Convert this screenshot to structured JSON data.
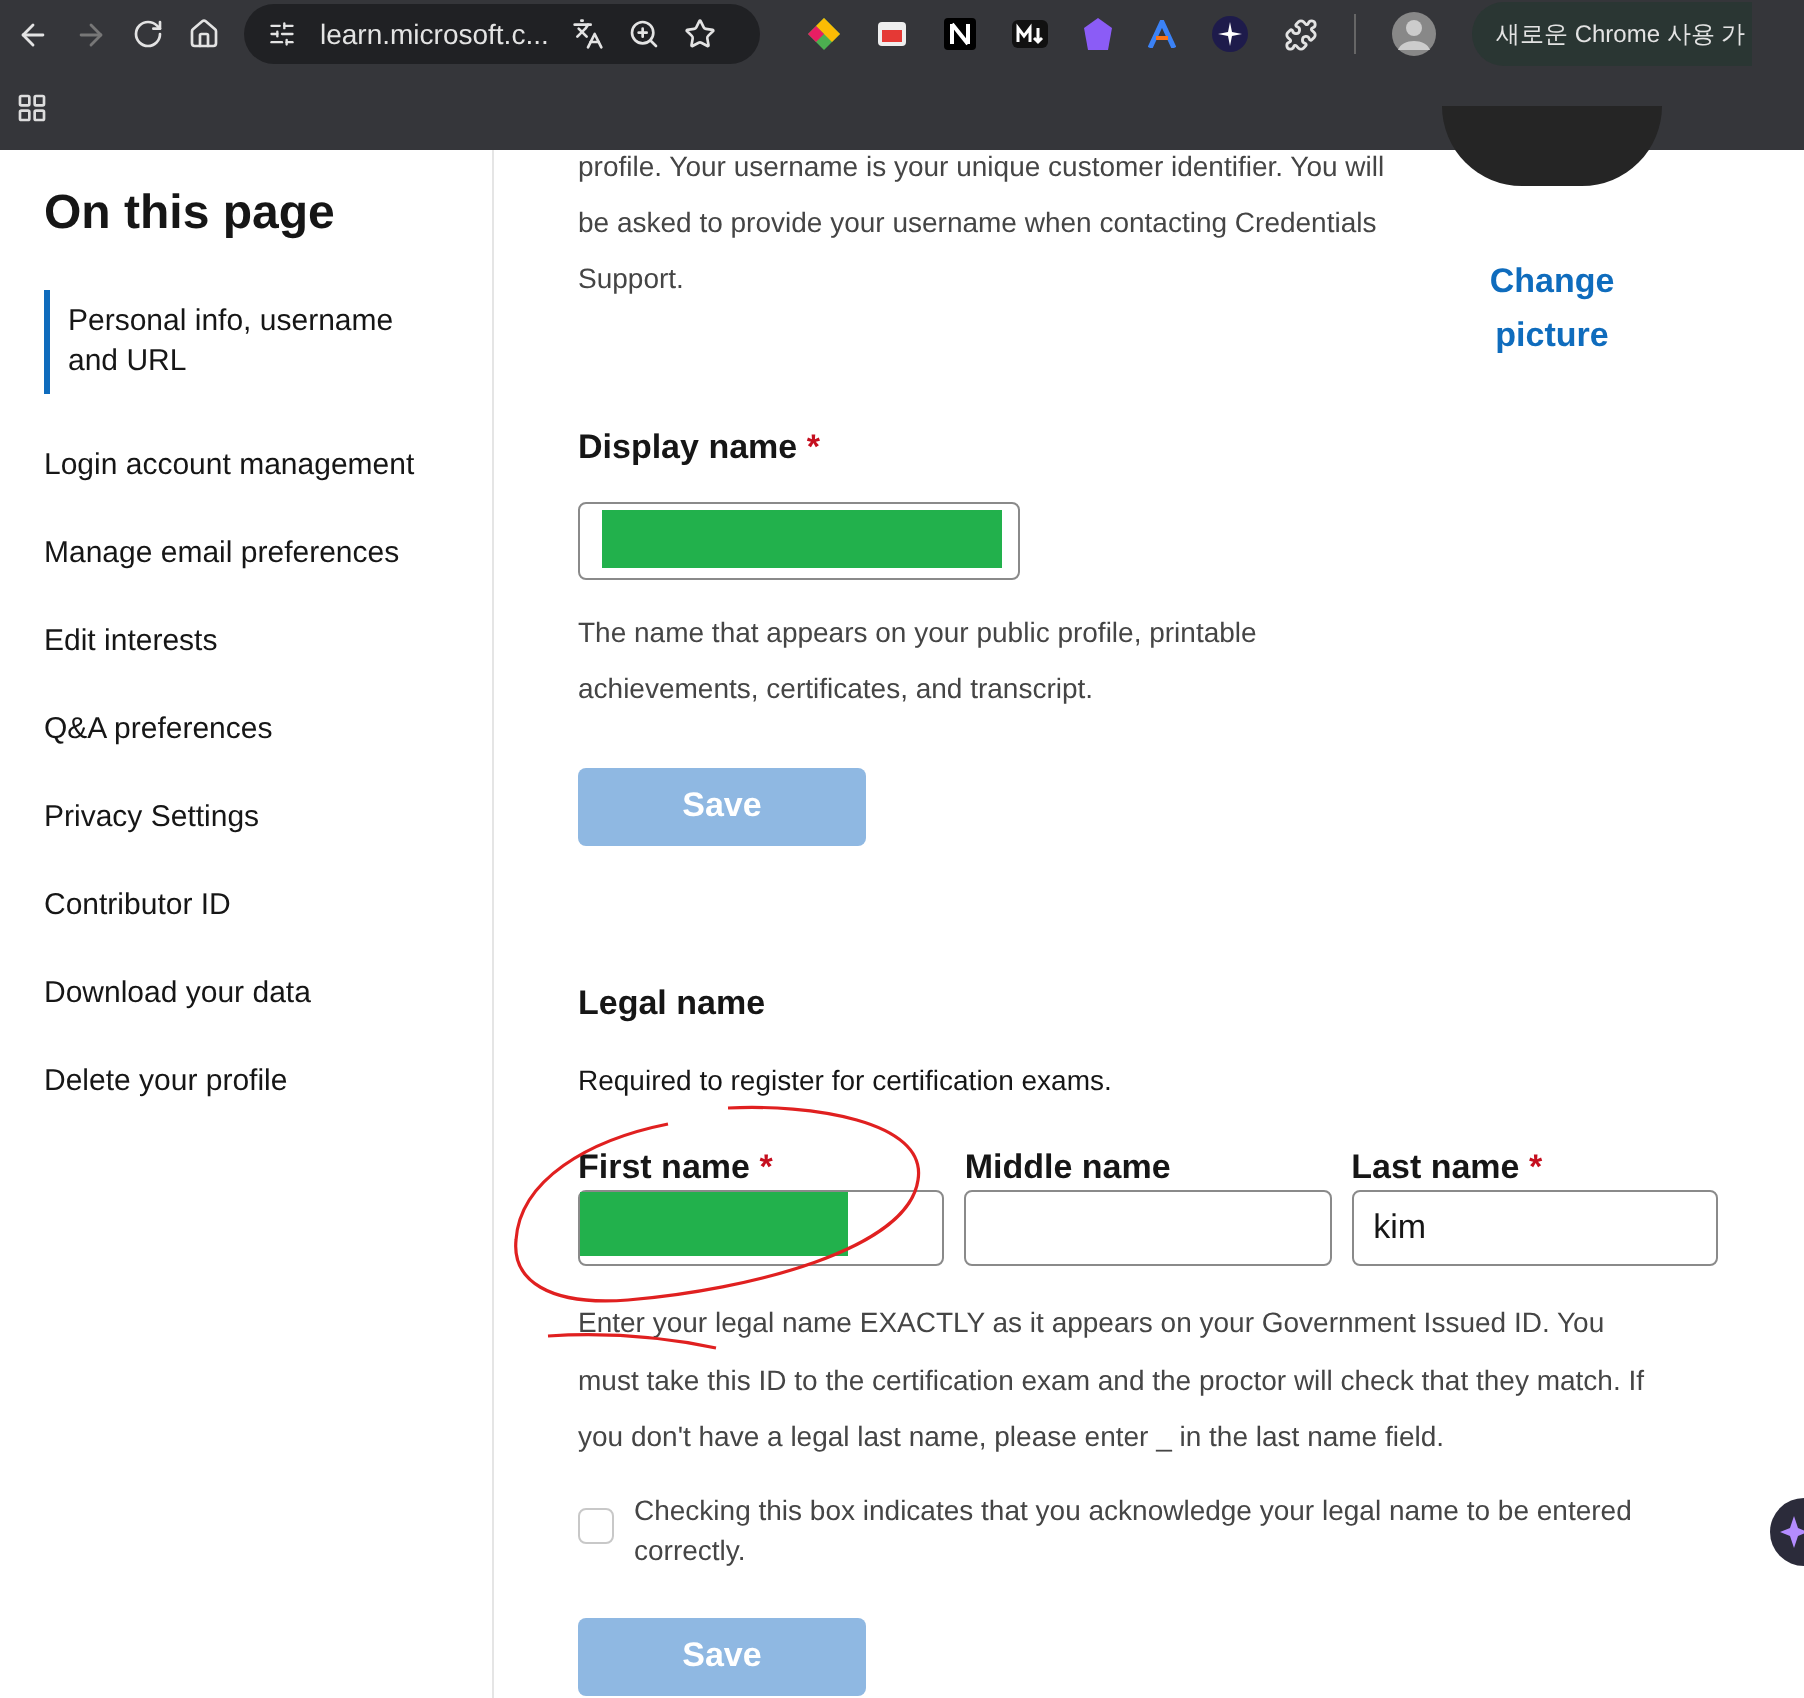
{
  "browser": {
    "url": "learn.microsoft.c...",
    "update_pill": "새로운 Chrome 사용 가",
    "forward_disabled": true
  },
  "sidebar": {
    "title": "On this page",
    "items": [
      {
        "label": "Personal info, username and URL",
        "selected": true
      },
      {
        "label": "Login account management",
        "selected": false
      },
      {
        "label": "Manage email preferences",
        "selected": false
      },
      {
        "label": "Edit interests",
        "selected": false
      },
      {
        "label": "Q&A preferences",
        "selected": false
      },
      {
        "label": "Privacy Settings",
        "selected": false
      },
      {
        "label": "Contributor ID",
        "selected": false
      },
      {
        "label": "Download your data",
        "selected": false
      },
      {
        "label": "Delete your profile",
        "selected": false
      }
    ]
  },
  "intro": "profile. Your username is your unique customer identifier. You will be asked to provide your username when contacting Credentials Support.",
  "change_picture": "Change picture",
  "display_name": {
    "label": "Display name",
    "required_mark": "*",
    "redacted": true,
    "help": "The name that appears on your public profile, printable achievements, certificates, and transcript.",
    "save": {
      "label": "Save",
      "disabled": true
    }
  },
  "legal_name": {
    "title": "Legal name",
    "subtitle": "Required to register for certification exams.",
    "fields": [
      {
        "label": "First name",
        "required_mark": "*",
        "redacted": true
      },
      {
        "label": "Middle name",
        "redacted": false
      },
      {
        "label": "Last name",
        "required_mark": "*",
        "value": "kim",
        "redacted": false
      }
    ],
    "help": "Enter your legal name EXACTLY as it appears on your Government Issued ID. You must take this ID to the certification exam and the proctor will check that they match. If you don't have a legal last name, please enter _ in the last name field.",
    "acknowledge": {
      "label": "Checking this box indicates that you acknowledge your legal name to be entered correctly.",
      "checked": false
    },
    "save": {
      "label": "Save",
      "disabled": true
    }
  }
}
